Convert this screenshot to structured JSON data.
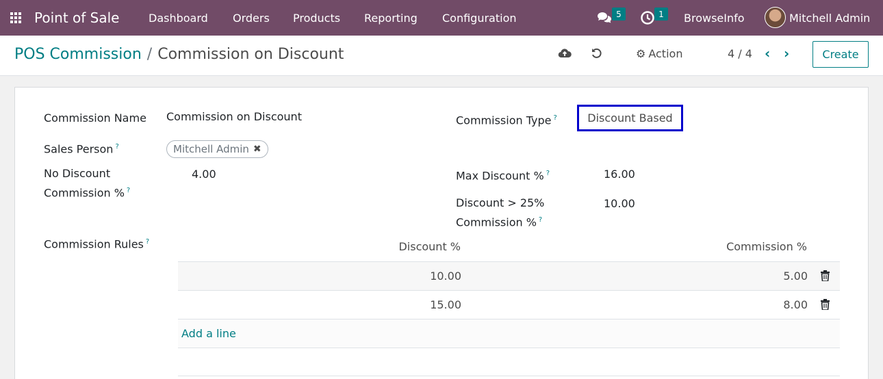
{
  "navbar": {
    "app_name": "Point of Sale",
    "menu": [
      "Dashboard",
      "Orders",
      "Products",
      "Reporting",
      "Configuration"
    ],
    "messages_count": "5",
    "activities_count": "1",
    "company": "BrowseInfo",
    "user": "Mitchell Admin"
  },
  "control": {
    "breadcrumb_parent": "POS Commission",
    "breadcrumb_sep": "/",
    "breadcrumb_current": "Commission on Discount",
    "action_label": "Action",
    "pager": "4 / 4",
    "create_label": "Create"
  },
  "form": {
    "commission_name_label": "Commission Name",
    "commission_name_value": "Commission on Discount",
    "commission_type_label": "Commission Type",
    "commission_type_value": "Discount Based",
    "sales_person_label": "Sales Person",
    "sales_person_tag": "Mitchell Admin",
    "no_discount_label_1": "No Discount",
    "no_discount_label_2": "Commission %",
    "no_discount_value": "4.00",
    "max_discount_label": "Max Discount %",
    "max_discount_value": "16.00",
    "discount_gt_label_1": "Discount > 25%",
    "discount_gt_label_2": "Commission %",
    "discount_gt_value": "10.00",
    "rules_label": "Commission Rules",
    "help_mark": "?"
  },
  "rules_table": {
    "headers": [
      "Discount %",
      "Commission %"
    ],
    "rows": [
      {
        "discount": "10.00",
        "commission": "5.00"
      },
      {
        "discount": "15.00",
        "commission": "8.00"
      }
    ],
    "add_line": "Add a line"
  },
  "colors": {
    "navbar": "#714b67",
    "accent": "#017e84",
    "focus_border": "#0000cc"
  }
}
